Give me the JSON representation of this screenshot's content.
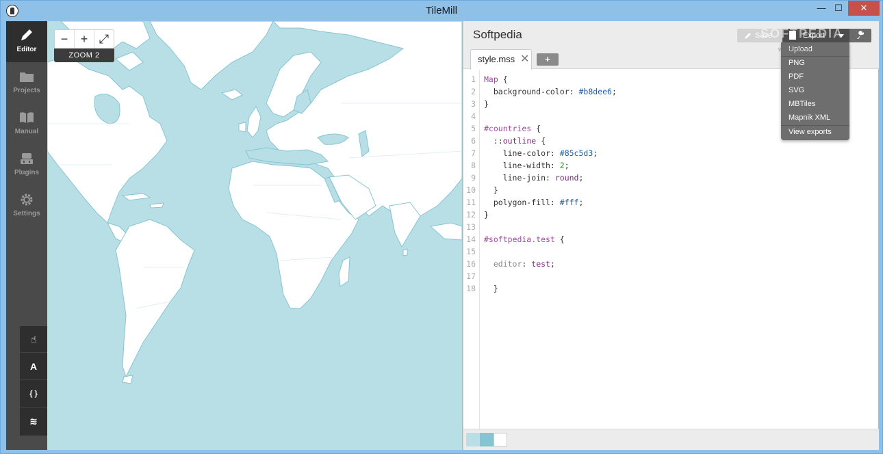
{
  "window": {
    "title": "TileMill"
  },
  "nav": {
    "items": [
      {
        "label": "Editor",
        "icon": "pencil-icon",
        "active": true
      },
      {
        "label": "Projects",
        "icon": "folder-icon",
        "active": false
      },
      {
        "label": "Manual",
        "icon": "book-icon",
        "active": false
      },
      {
        "label": "Plugins",
        "icon": "plugin-icon",
        "active": false
      },
      {
        "label": "Settings",
        "icon": "gear-icon",
        "active": false
      }
    ]
  },
  "map": {
    "zoom_label": "ZOOM 2",
    "zoom_out": "−",
    "zoom_in": "+",
    "fullscreen": "⤢",
    "colors": {
      "water": "#b8dee6",
      "land": "#ffffff",
      "outline": "#85c5d3"
    }
  },
  "tools": [
    {
      "icon": "hand-pointer-icon",
      "glyph": "☝"
    },
    {
      "icon": "font-icon",
      "glyph": "A"
    },
    {
      "icon": "braces-icon",
      "glyph": "{ }"
    },
    {
      "icon": "layers-icon",
      "glyph": "≋"
    }
  ],
  "editor": {
    "project_title": "Softpedia",
    "save_label": "Save",
    "export_label": "Export",
    "tab_label": "style.mss",
    "tab_close": "✕",
    "tab_add": "+",
    "line_numbers": [
      "1",
      "2",
      "3",
      "4",
      "5",
      "6",
      "7",
      "8",
      "9",
      "10",
      "11",
      "12",
      "13",
      "14",
      "15",
      "16",
      "17",
      "18"
    ]
  },
  "dropdown": {
    "items": [
      "Upload",
      "PNG",
      "PDF",
      "SVG",
      "MBTiles",
      "Mapnik XML",
      "View exports"
    ]
  },
  "footer": {
    "swatches": [
      "#b8dee6",
      "#85c5d3",
      "#ffffff"
    ]
  },
  "watermark": {
    "text": "SOFTPEDIA",
    "sub": "www.softpedia.com"
  }
}
